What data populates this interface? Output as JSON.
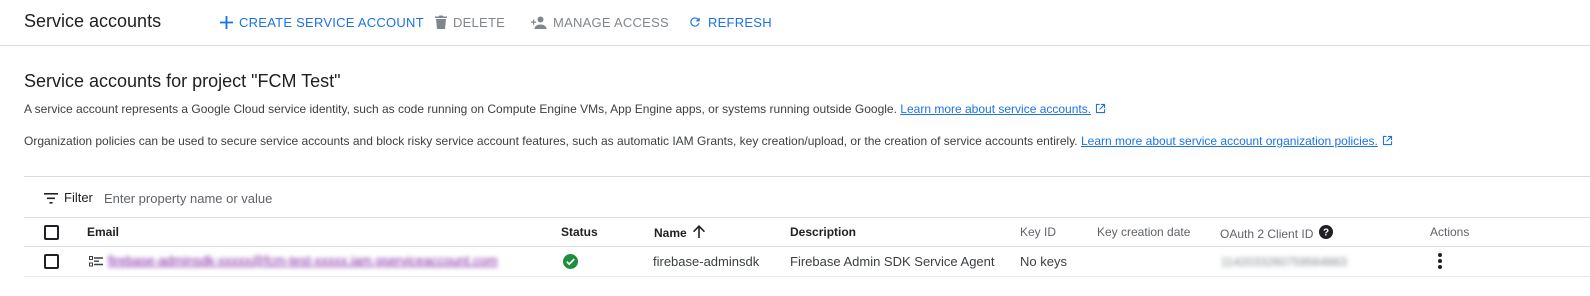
{
  "header": {
    "title": "Service accounts",
    "create_label": "CREATE SERVICE ACCOUNT",
    "delete_label": "DELETE",
    "manage_access_label": "MANAGE ACCESS",
    "refresh_label": "REFRESH"
  },
  "section": {
    "title": "Service accounts for project \"FCM Test\"",
    "para1_text": "A service account represents a Google Cloud service identity, such as code running on Compute Engine VMs, App Engine apps, or systems running outside Google.",
    "para1_link": "Learn more about service accounts.",
    "para2_text": "Organization policies can be used to secure service accounts and block risky service account features, such as automatic IAM Grants, key creation/upload, or the creation of service accounts entirely.",
    "para2_link": "Learn more about service account organization policies."
  },
  "filter": {
    "label": "Filter",
    "placeholder": "Enter property name or value"
  },
  "table": {
    "headers": {
      "email": "Email",
      "status": "Status",
      "name": "Name",
      "description": "Description",
      "key_id": "Key ID",
      "key_creation_date": "Key creation date",
      "oauth_client_id": "OAuth 2 Client ID",
      "actions": "Actions"
    },
    "rows": [
      {
        "email": "firebase-adminsdk-xxxxx@fcm-test-xxxxx.iam.gserviceaccount.com",
        "name": "firebase-adminsdk",
        "description": "Firebase Admin SDK Service Agent",
        "key_id": "No keys",
        "key_creation_date": "",
        "oauth_client_id": "1142033260759564863"
      }
    ]
  },
  "colors": {
    "accent": "#1a73e8",
    "status_ok": "#1e8e3e",
    "visited_link": "#7b1fa2"
  },
  "icons": {
    "create": "plus-icon",
    "delete": "trash-icon",
    "manage_access": "person-add-icon",
    "refresh": "refresh-icon",
    "filter": "filter-icon",
    "sort": "arrow-up-icon",
    "help": "help-circle-icon",
    "status": "check-circle-icon",
    "account": "service-account-icon",
    "actions": "more-vert-icon",
    "external": "external-link-icon"
  }
}
